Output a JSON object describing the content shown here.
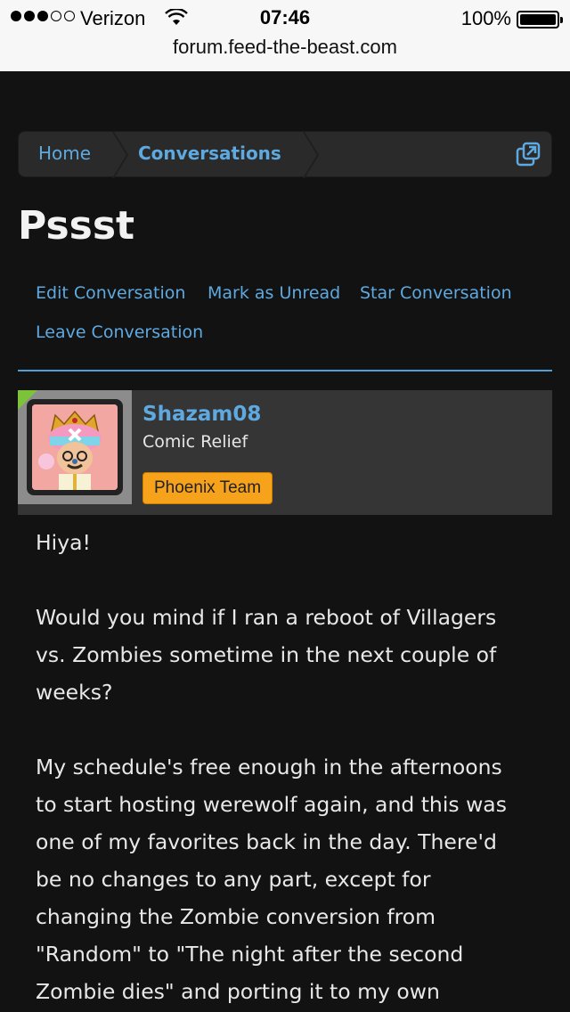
{
  "status_bar": {
    "carrier": "Verizon",
    "time": "07:46",
    "battery": "100%",
    "url": "forum.feed-the-beast.com"
  },
  "breadcrumb": {
    "home": "Home",
    "current": "Conversations"
  },
  "page": {
    "title": "Pssst"
  },
  "actions": {
    "edit": "Edit Conversation",
    "mark_unread": "Mark as Unread",
    "star": "Star Conversation",
    "leave": "Leave Conversation"
  },
  "message": {
    "username": "Shazam08",
    "user_title": "Comic Relief",
    "badge": "Phoenix Team",
    "paragraphs": [
      "Hiya!",
      "Would you mind if I ran a reboot of Villagers\nvs. Zombies sometime in the next couple of\nweeks?",
      "My schedule's free enough in the afternoons\nto start hosting werewolf again, and this was\none of my favorites back in the day. There'd\nbe no changes to any part, except for\nchanging the Zombie conversion from\n\"Random\" to \"The night after the second\nZombie dies\" and porting it to my own"
    ]
  },
  "colors": {
    "link": "#5ea9e0",
    "badge": "#f7a21b",
    "background": "#121212"
  }
}
